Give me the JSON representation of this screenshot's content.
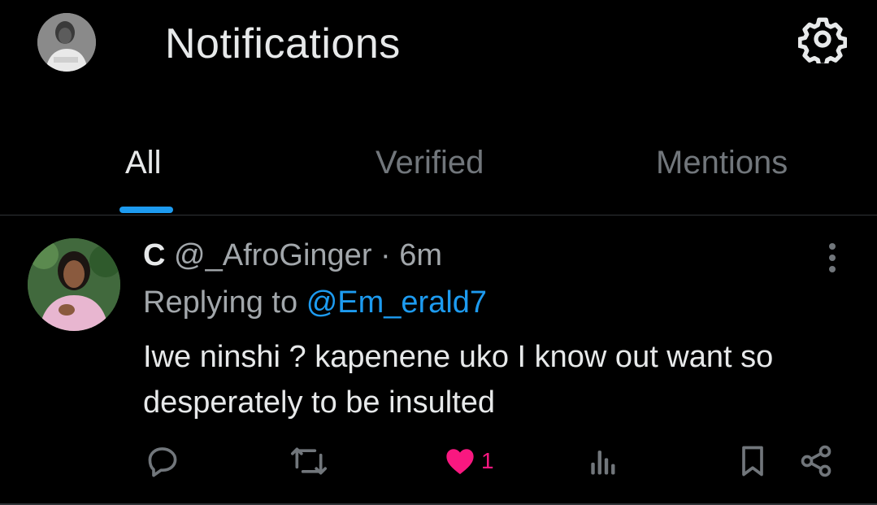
{
  "header": {
    "title": "Notifications",
    "avatar_icon": "profile-avatar",
    "settings_icon": "gear-icon"
  },
  "tabs": [
    {
      "label": "All",
      "active": true
    },
    {
      "label": "Verified",
      "active": false
    },
    {
      "label": "Mentions",
      "active": false
    }
  ],
  "post": {
    "author_name": "C",
    "author_handle": "@_AfroGinger",
    "separator": "·",
    "time": "6m",
    "reply_prefix": "Replying to",
    "reply_handle": "@Em_erald7",
    "text": "Iwe ninshi ? kapenene uko I know out want so desperately to be insulted",
    "actions": {
      "reply_icon": "reply-icon",
      "repost_icon": "repost-icon",
      "like_icon": "heart-icon",
      "like_count": "1",
      "views_icon": "views-icon",
      "bookmark_icon": "bookmark-icon",
      "share_icon": "share-icon"
    }
  },
  "colors": {
    "background": "#000000",
    "accent": "#1d9bf0",
    "like": "#f91880",
    "text_primary": "#e7e9ea",
    "text_secondary": "#71767b",
    "divider": "#2f3336"
  }
}
